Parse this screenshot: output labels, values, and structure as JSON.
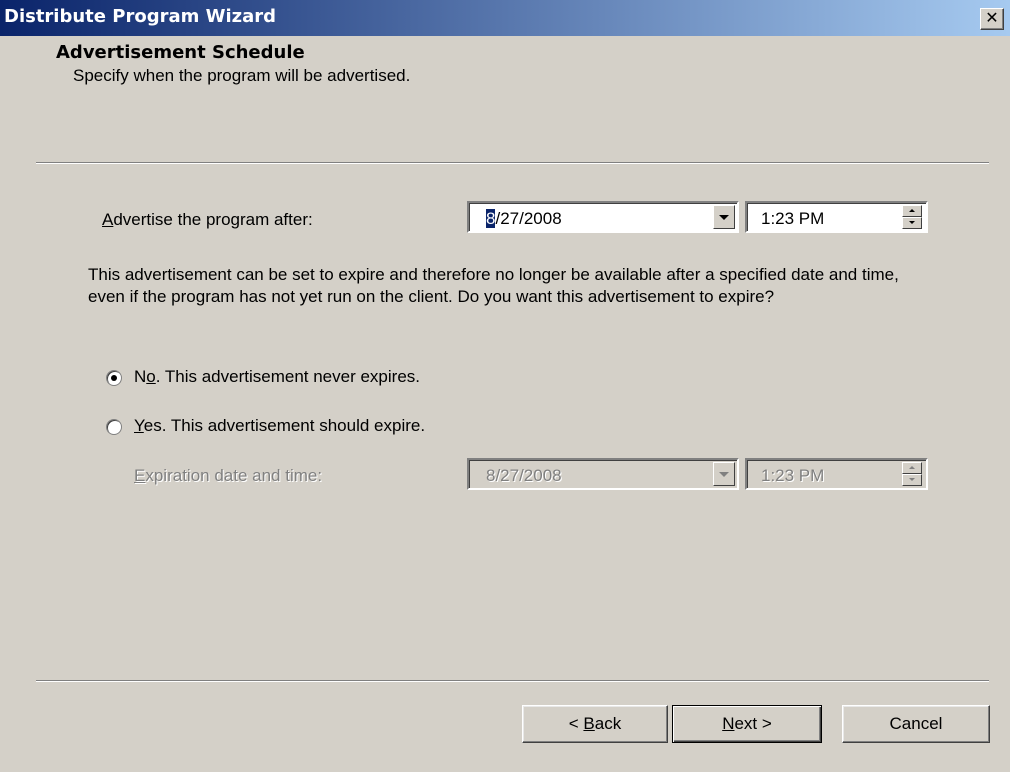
{
  "window": {
    "title": "Distribute Program Wizard",
    "close_label": "✕"
  },
  "header": {
    "title": "Advertisement Schedule",
    "subtitle": "Specify when the program will be advertised."
  },
  "advertise": {
    "label_prefix": "",
    "label_accel": "A",
    "label_rest": "dvertise the program after:",
    "date_sel": "8",
    "date_rest": "/27/2008",
    "time": "1:23 PM"
  },
  "description": "This advertisement can be set to expire and therefore no longer be available after a specified date and time, even if the program has not yet run on the client. Do you want this advertisement to expire?",
  "options": {
    "no": {
      "pre": "N",
      "accel": "o",
      "post": ". This advertisement never expires.",
      "selected": true
    },
    "yes": {
      "pre": "",
      "accel": "Y",
      "post": "es. This advertisement should expire.",
      "selected": false
    }
  },
  "expiration": {
    "label_accel": "E",
    "label_rest": "xpiration date and time:",
    "date": "8/27/2008",
    "time": "1:23 PM",
    "enabled": false
  },
  "buttons": {
    "back_pre": "< ",
    "back_accel": "B",
    "back_rest": "ack",
    "next_accel": "N",
    "next_rest": "ext >",
    "cancel": "Cancel"
  },
  "colors": {
    "dialog_bg": "#d4d0c8",
    "title_start": "#0a246a",
    "title_end": "#a6caf0",
    "disabled_text": "#808080"
  }
}
